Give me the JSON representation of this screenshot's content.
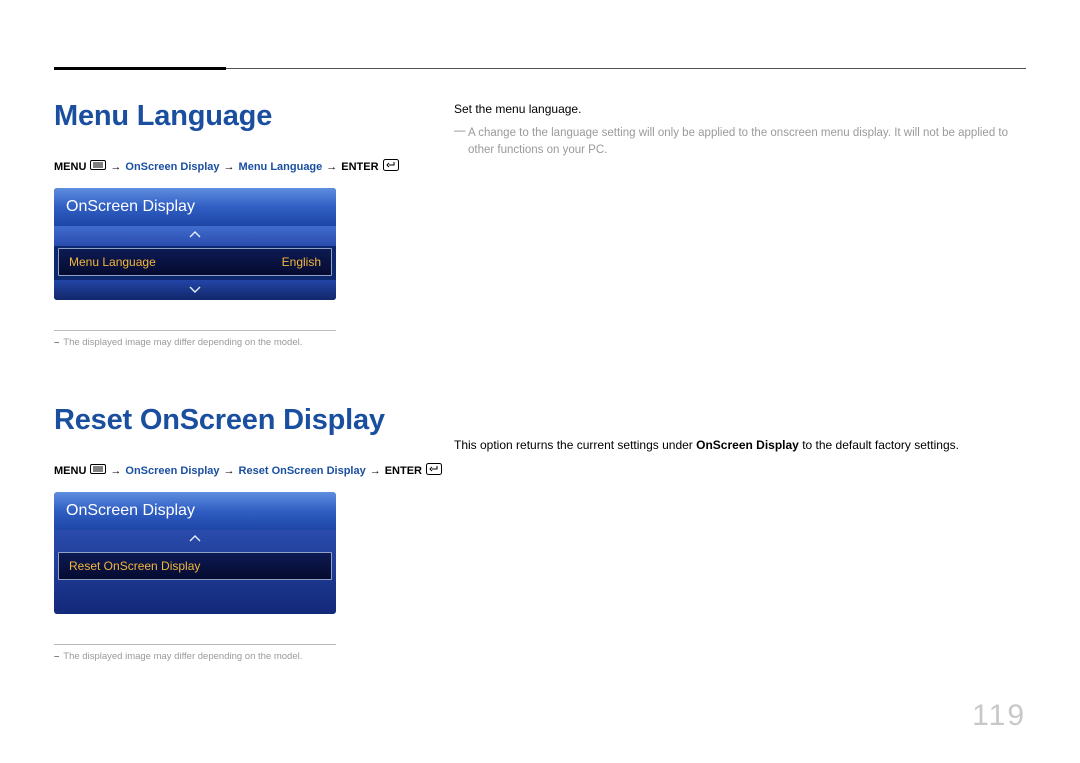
{
  "page_number": "119",
  "section1": {
    "title": "Menu Language",
    "breadcrumb": {
      "menu": "MENU",
      "osd": "OnScreen Display",
      "item": "Menu Language",
      "enter": "ENTER"
    },
    "osd": {
      "header": "OnScreen Display",
      "row_label": "Menu Language",
      "row_value": "English"
    },
    "footnote": "The displayed image may differ depending on the model.",
    "body_line1": "Set the menu language.",
    "body_note": "A change to the language setting will only be applied to the onscreen menu display. It will not be applied to other functions on your PC."
  },
  "section2": {
    "title": "Reset OnScreen Display",
    "breadcrumb": {
      "menu": "MENU",
      "osd": "OnScreen Display",
      "item": "Reset OnScreen Display",
      "enter": "ENTER"
    },
    "osd": {
      "header": "OnScreen Display",
      "row_label": "Reset OnScreen Display"
    },
    "footnote": "The displayed image may differ depending on the model.",
    "body_pre": "This option returns the current settings under ",
    "body_strong": "OnScreen Display",
    "body_post": " to the default factory settings."
  }
}
